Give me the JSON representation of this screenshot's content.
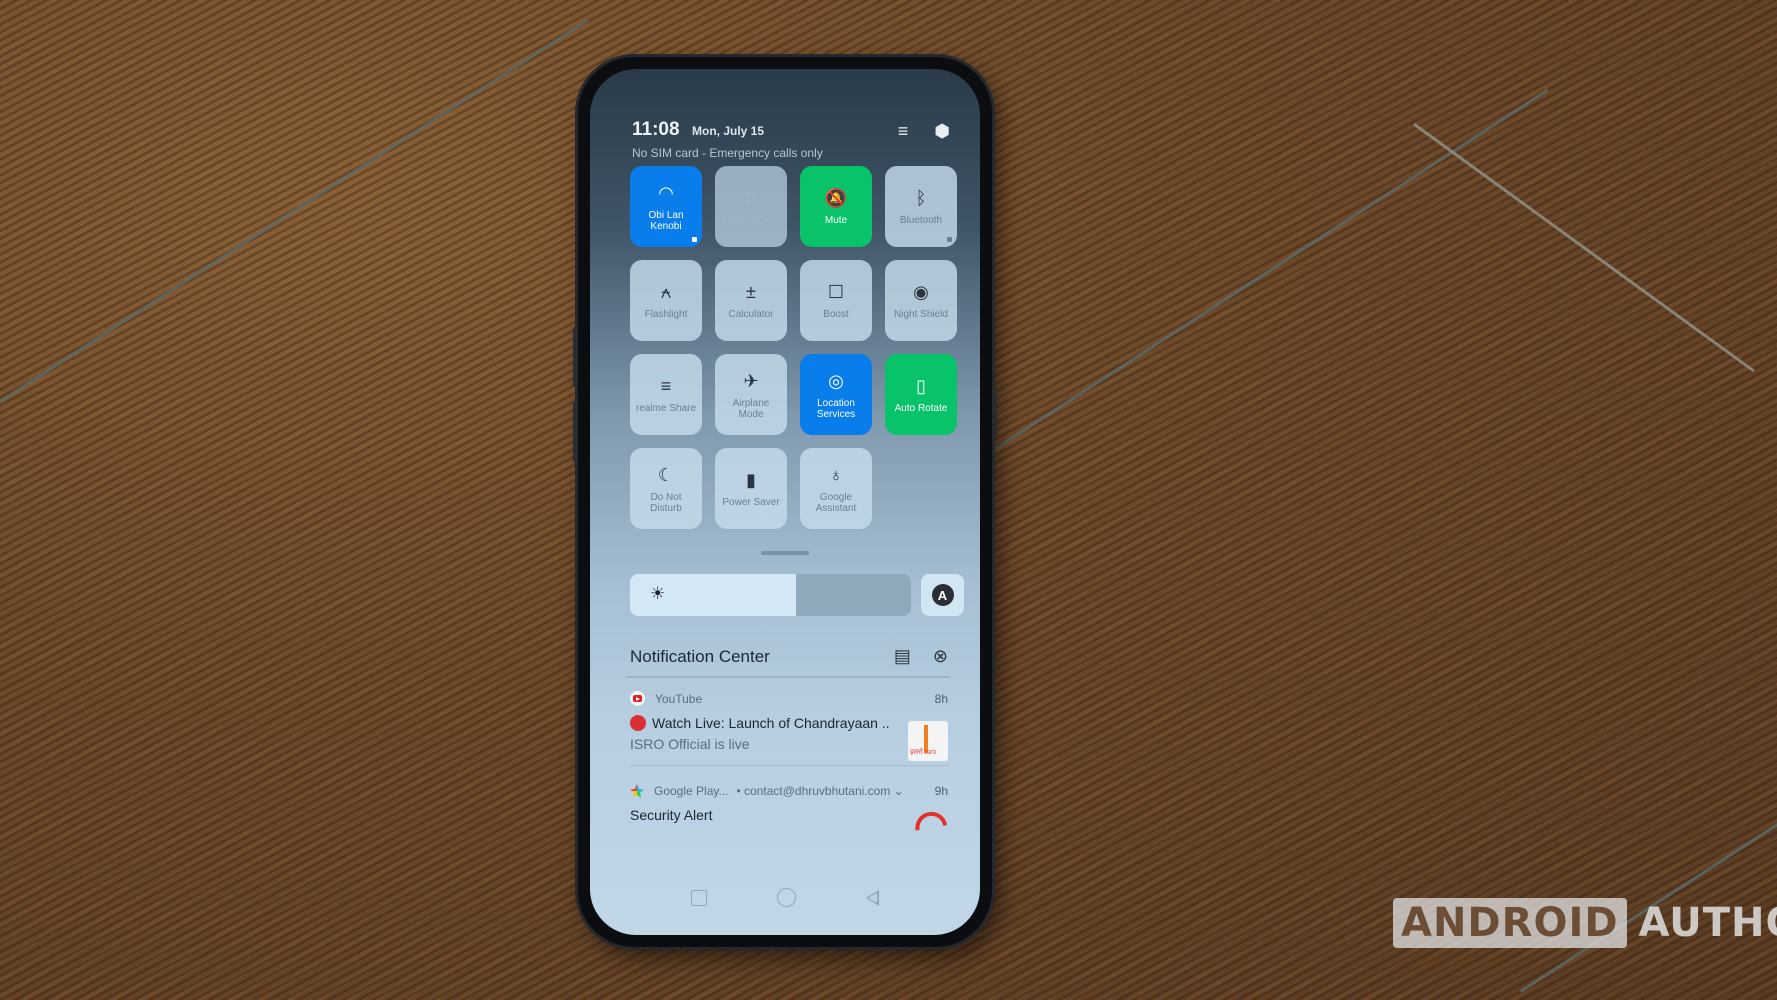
{
  "status_bar": {
    "time": "11:08",
    "date": "Mon, July 15",
    "carrier": "No SIM card - Emergency calls only",
    "icons": [
      "edit-tiles-icon",
      "settings-gear-icon"
    ]
  },
  "quick_tiles": [
    {
      "label": "Obi Lan Kenobi",
      "icon": "wifi-icon",
      "glyph": "◠",
      "state": "on",
      "color": "#0a7dec"
    },
    {
      "label": "Cellular Data",
      "icon": "cellular-data-icon",
      "glyph": "⇅",
      "state": "disabled"
    },
    {
      "label": "Mute",
      "icon": "mute-bell-icon",
      "glyph": "🔕",
      "state": "on",
      "color": "#08c36a"
    },
    {
      "label": "Bluetooth",
      "icon": "bluetooth-icon",
      "glyph": "ᛒ",
      "state": "off"
    },
    {
      "label": "Flashlight",
      "icon": "flashlight-icon",
      "glyph": "⍲",
      "state": "off"
    },
    {
      "label": "Calculator",
      "icon": "calculator-icon",
      "glyph": "±",
      "state": "off"
    },
    {
      "label": "Boost",
      "icon": "boost-trash-icon",
      "glyph": "☐",
      "state": "off"
    },
    {
      "label": "Night Shield",
      "icon": "eye-icon",
      "glyph": "◉",
      "state": "off"
    },
    {
      "label": "realme Share",
      "icon": "realme-share-icon",
      "glyph": "≡",
      "state": "off"
    },
    {
      "label": "Airplane Mode",
      "icon": "airplane-icon",
      "glyph": "✈",
      "state": "off"
    },
    {
      "label": "Location Services",
      "icon": "location-pin-icon",
      "glyph": "◎",
      "state": "on",
      "color": "#0a7dec"
    },
    {
      "label": "Auto Rotate",
      "icon": "auto-rotate-icon",
      "glyph": "▯",
      "state": "on",
      "color": "#08c36a"
    },
    {
      "label": "Do Not Disturb",
      "icon": "moon-icon",
      "glyph": "☾",
      "state": "off"
    },
    {
      "label": "Power Saver",
      "icon": "battery-icon",
      "glyph": "▮",
      "state": "off"
    },
    {
      "label": "Google Assistant",
      "icon": "microphone-icon",
      "glyph": "♁",
      "state": "off"
    }
  ],
  "brightness": {
    "level_percent": 59,
    "icon": "sun-icon",
    "glyph": "☀",
    "auto_label": "A"
  },
  "notification_center": {
    "title": "Notification Center",
    "icons": [
      "manage-notifications-icon",
      "clear-all-icon"
    ],
    "icon_glyphs": [
      "▤",
      "⊗"
    ],
    "notifications": [
      {
        "app": "YouTube",
        "time": "8h",
        "title": "Watch Live: Launch of Chandrayaan ..",
        "subtitle": "ISRO Official is live",
        "thumbnail_text": "इसरो isro"
      },
      {
        "app": "Google Play...",
        "account": "• contact@dhruvbhutani.com ⌄",
        "time": "9h",
        "title": "Security Alert"
      }
    ]
  },
  "watermark": {
    "boxed": "ANDROID",
    "text": "AUTHORITY"
  }
}
